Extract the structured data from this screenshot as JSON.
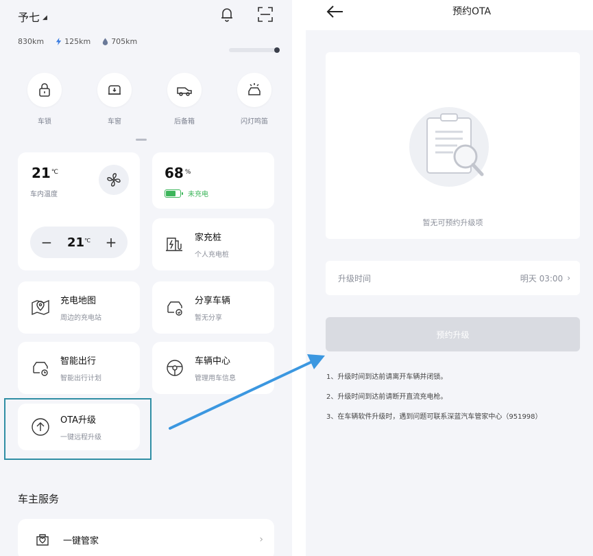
{
  "left": {
    "owner": "予七",
    "stats": {
      "range": "830km",
      "electric": "125km",
      "fuel": "705km"
    },
    "quick_actions": [
      {
        "label": "车锁",
        "icon": "lock-icon"
      },
      {
        "label": "车窗",
        "icon": "car-window-icon"
      },
      {
        "label": "后备箱",
        "icon": "trunk-icon"
      },
      {
        "label": "闪灯鸣笛",
        "icon": "flash-horn-icon"
      }
    ],
    "climate": {
      "temp": "21",
      "unit": "℃",
      "label": "车内温度",
      "setpoint": "21",
      "minus": "−",
      "plus": "+"
    },
    "battery": {
      "percent": "68",
      "unit": "%",
      "status": "未充电",
      "level": 0.68
    },
    "cards": {
      "home_charger": {
        "title": "家充桩",
        "sub": "个人充电桩"
      },
      "charge_map": {
        "title": "充电地图",
        "sub": "周边的充电站"
      },
      "share_car": {
        "title": "分享车辆",
        "sub": "暂无分享"
      },
      "smart_trip": {
        "title": "智能出行",
        "sub": "智能出行计划"
      },
      "vehicle_center": {
        "title": "车辆中心",
        "sub": "管理用车信息"
      },
      "ota": {
        "title": "OTA升级",
        "sub": "一键远程升级"
      }
    },
    "owner_services_title": "车主服务",
    "butler": {
      "label": "一键管家",
      "chevron": "›"
    }
  },
  "right": {
    "title": "预约OTA",
    "empty_text": "暂无可预约升级项",
    "time_label": "升级时间",
    "time_value": "明天 03:00",
    "time_chevron": "›",
    "reserve_button": "预约升级",
    "notes": [
      "1、升级时间到达前请离开车辆并闭锁。",
      "2、升级时间到达前请断开直流充电枪。",
      "3、在车辆软件升级时，遇到问题可联系深蓝汽车管家中心（951998）"
    ]
  },
  "colors": {
    "accent_blue": "#3b97e0",
    "highlight_border": "#2f8ea4",
    "battery_green": "#3cb55a",
    "disabled_button": "#d9dbe1"
  }
}
